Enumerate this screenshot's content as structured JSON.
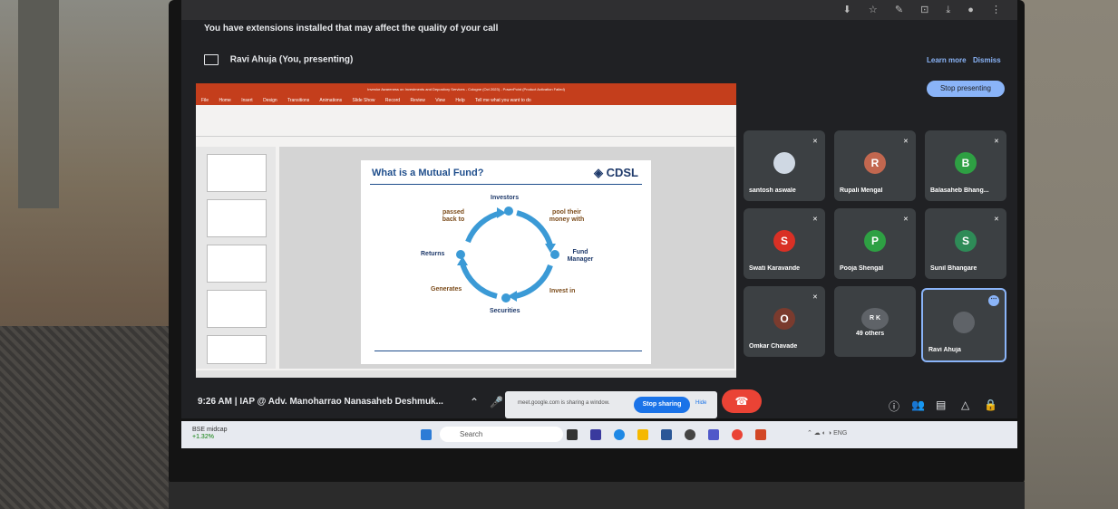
{
  "meet": {
    "extensions_notice": "You have extensions installed that may affect the quality of your call",
    "presenting_label": "Ravi Ahuja (You, presenting)",
    "learn_more": "Learn more",
    "dismiss": "Dismiss",
    "stop_presenting": "Stop presenting",
    "time_meeting": "9:26 AM  |  IAP @ Adv. Manoharrao Nanasaheb Deshmuk...",
    "share_notice": "meet.google.com is sharing a window.",
    "stop_sharing": "Stop sharing",
    "hide": "Hide"
  },
  "ppt": {
    "title": "Investor Awareness on Investments and Depository Services - Cologne (Oct 2023) - PowerPoint (Product Activation Failed)",
    "tabs": [
      "File",
      "Home",
      "Insert",
      "Design",
      "Transitions",
      "Animations",
      "Slide Show",
      "Record",
      "Review",
      "View",
      "Help",
      "Tell me what you want to do"
    ],
    "slide": {
      "title": "What is a Mutual Fund?",
      "logo": "CDSL",
      "labels": {
        "investors": "Investors",
        "pool": "pool their money with",
        "fund_manager": "Fund Manager",
        "invest_in": "Invest in",
        "securities": "Securities",
        "generates": "Generates",
        "returns": "Returns",
        "passed": "passed back to"
      }
    }
  },
  "participants": [
    {
      "name": "santosh aswale",
      "initial": "",
      "color": "#cfd8e3"
    },
    {
      "name": "Rupali Mengal",
      "initial": "R",
      "color": "#c2674f"
    },
    {
      "name": "Balasaheb Bhang...",
      "initial": "B",
      "color": "#2ea043"
    },
    {
      "name": "Swati Karavande",
      "initial": "S",
      "color": "#d93025"
    },
    {
      "name": "Pooja Shengal",
      "initial": "P",
      "color": "#2ea043"
    },
    {
      "name": "Sunil Bhangare",
      "initial": "S",
      "color": "#2e8b57"
    },
    {
      "name": "Omkar Chavade",
      "initial": "O",
      "color": "#7a3b2e"
    },
    {
      "name": "49 others",
      "initial": "",
      "color": "#5f6368"
    },
    {
      "name": "Ravi Ahuja",
      "initial": "",
      "color": "#5f6368"
    }
  ],
  "taskbar": {
    "stock_name": "BSE midcap",
    "stock_change": "+1.32%",
    "search": "Search"
  }
}
